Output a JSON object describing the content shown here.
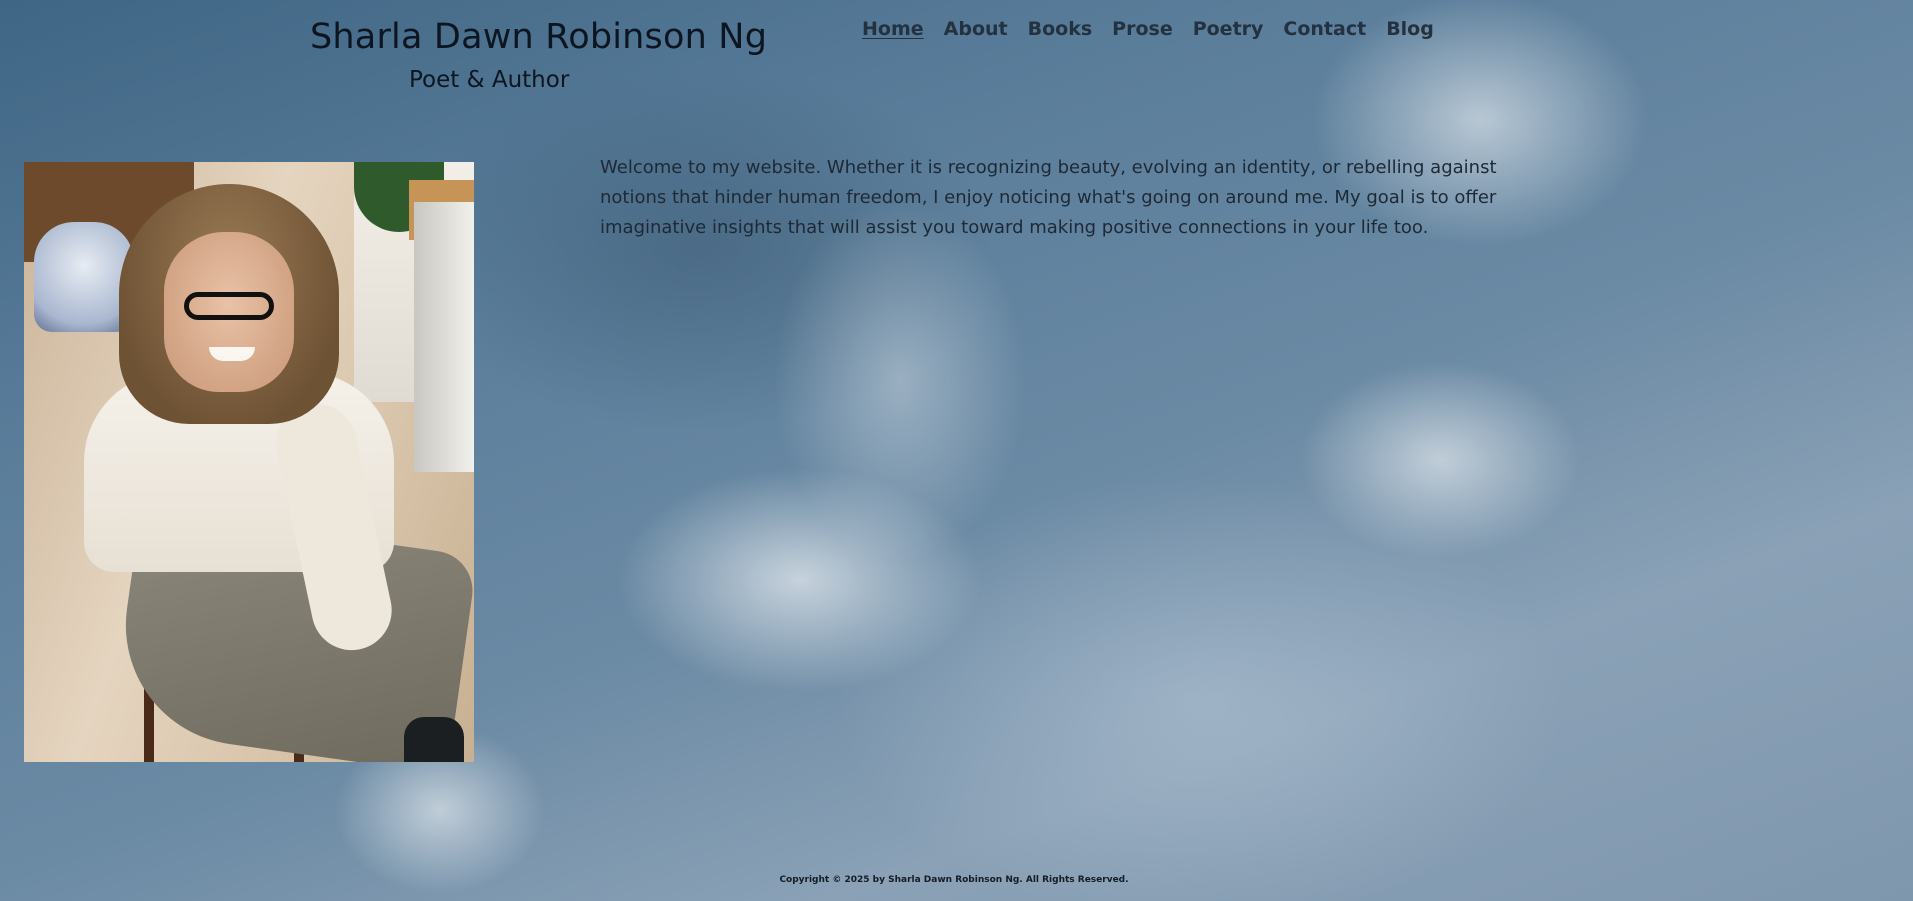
{
  "header": {
    "title": "Sharla Dawn Robinson Ng",
    "subtitle": "Poet & Author"
  },
  "nav": {
    "items": [
      {
        "label": "Home",
        "active": true
      },
      {
        "label": "About"
      },
      {
        "label": "Books"
      },
      {
        "label": "Prose"
      },
      {
        "label": "Poetry"
      },
      {
        "label": "Contact"
      },
      {
        "label": "Blog"
      }
    ]
  },
  "main": {
    "welcome": "Welcome to my website. Whether it is recognizing beauty, evolving an identity, or rebelling against notions that hinder human freedom, I enjoy noticing what's going on around me. My goal is to offer imaginative insights that will assist you toward making positive connections in your life too."
  },
  "footer": {
    "copyright": "Copyright © 2025 by Sharla Dawn Robinson Ng. All Rights Reserved."
  },
  "colors": {
    "sky_dark": "#3f6685",
    "sky_light": "#8aa1b6",
    "text": "#0d1620",
    "nav_text": "#24313f"
  }
}
